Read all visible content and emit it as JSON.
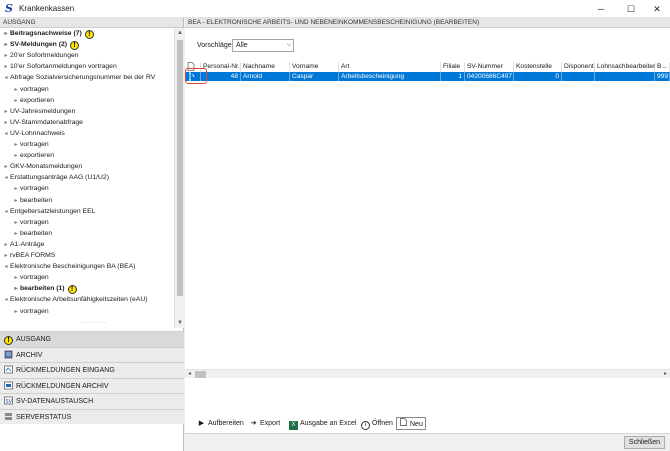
{
  "window": {
    "title": "Krankenkassen",
    "minimize": "─",
    "maximize": "☐",
    "close": "✕"
  },
  "left": {
    "header": "AUSGANG",
    "tree": [
      {
        "label": "Beitragsnachweise (7)",
        "indent": 1,
        "arrow": "▸",
        "bold": true,
        "warn": true
      },
      {
        "label": "SV-Meldungen (2)",
        "indent": 1,
        "arrow": "▸",
        "bold": true,
        "warn": true
      },
      {
        "label": "20'er Sofortmeldungen",
        "indent": 1,
        "arrow": "▸"
      },
      {
        "label": "10'er Sofortanmeldungen vortragen",
        "indent": 1,
        "arrow": "▸"
      },
      {
        "label": "Abfrage Sozialversicherungsnummer bei der RV",
        "indent": 1,
        "arrow": "◂"
      },
      {
        "label": "vortragen",
        "indent": 2,
        "arrow": "▸"
      },
      {
        "label": "exportieren",
        "indent": 2,
        "arrow": "▸"
      },
      {
        "label": "UV-Jahresmeldungen",
        "indent": 1,
        "arrow": "▸"
      },
      {
        "label": "UV-Stammdatenabfrage",
        "indent": 1,
        "arrow": "▸"
      },
      {
        "label": "UV-Lohnnachweis",
        "indent": 1,
        "arrow": "◂"
      },
      {
        "label": "vortragen",
        "indent": 2,
        "arrow": "▸"
      },
      {
        "label": "exportieren",
        "indent": 2,
        "arrow": "▸"
      },
      {
        "label": "GKV-Monatsmeldungen",
        "indent": 1,
        "arrow": "▸"
      },
      {
        "label": "Erstattungsanträge AAG (U1/U2)",
        "indent": 1,
        "arrow": "◂"
      },
      {
        "label": "vortragen",
        "indent": 2,
        "arrow": "▸"
      },
      {
        "label": "bearbeiten",
        "indent": 2,
        "arrow": "▸"
      },
      {
        "label": "Entgeltersatzleistungen EEL",
        "indent": 1,
        "arrow": "◂"
      },
      {
        "label": "vortragen",
        "indent": 2,
        "arrow": "▸"
      },
      {
        "label": "bearbeiten",
        "indent": 2,
        "arrow": "▸"
      },
      {
        "label": "A1-Anträge",
        "indent": 1,
        "arrow": "▸"
      },
      {
        "label": "rvBEA FORMS",
        "indent": 1,
        "arrow": "▸"
      },
      {
        "label": "Elektronische Bescheinigungen BA (BEA)",
        "indent": 1,
        "arrow": "◂"
      },
      {
        "label": "vortragen",
        "indent": 2,
        "arrow": "▸"
      },
      {
        "label": "bearbeiten (1)",
        "indent": 2,
        "arrow": "▸",
        "bold": true,
        "warn": true
      },
      {
        "label": "Elektronische Arbeitsunfähigkeitszeiten (eAU)",
        "indent": 1,
        "arrow": "◂"
      },
      {
        "label": "vortragen",
        "indent": 2,
        "arrow": "▸"
      }
    ],
    "nav": [
      {
        "label": "AUSGANG",
        "icon": "warning-icon",
        "active": true
      },
      {
        "label": "ARCHIV",
        "icon": "archive-icon"
      },
      {
        "label": "RÜCKMELDUNGEN EINGANG",
        "icon": "inbox-icon"
      },
      {
        "label": "RÜCKMELDUNGEN ARCHIV",
        "icon": "archive-return-icon"
      },
      {
        "label": "SV-DATENAUSTAUSCH",
        "icon": "exchange-icon"
      },
      {
        "label": "SERVERSTATUS",
        "icon": "server-icon"
      }
    ]
  },
  "right": {
    "header": "BEA - ELEKTRONISCHE ARBEITS- UND NEBENEINKOMMENSBESCHEINIGUNG (BEARBEITEN)",
    "filter": {
      "label": "Vorschläge:",
      "value": "Alle"
    },
    "columns": [
      "Personal-Nr.",
      "Nachname",
      "Vorname",
      "Art",
      "Filiale",
      "SV-Nummer",
      "Kostenstelle",
      "Disponent",
      "Lohnsachbearbeiter",
      "B..."
    ],
    "rows": [
      {
        "personal_nr": "48",
        "nachname": "Arnold",
        "vorname": "Caspar",
        "art": "Arbeitsbescheinigung",
        "filiale": "1",
        "sv_nummer": "04200686C497",
        "kostenstelle": "0",
        "disponent": "",
        "lohnsachbearbeiter": "",
        "b": "999"
      }
    ],
    "toolbar": [
      {
        "label": "Aufbereiten",
        "icon": "play-icon"
      },
      {
        "label": "Export",
        "icon": "arrow-right-icon"
      },
      {
        "label": "Ausgabe an Excel",
        "icon": "excel-icon"
      },
      {
        "label": "Öffnen",
        "icon": "info-icon"
      },
      {
        "label": "Neu",
        "icon": "new-document-icon"
      }
    ]
  },
  "footer": {
    "close_label": "Schließen"
  },
  "colors": {
    "selection": "#0078d7",
    "highlight_outline": "#e0443e",
    "warn": "#ffe600",
    "excel": "#1e7145"
  }
}
